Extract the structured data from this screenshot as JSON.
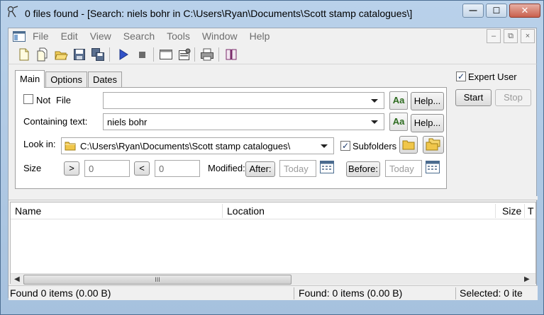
{
  "window": {
    "title": "0 files found - [Search: niels bohr in C:\\Users\\Ryan\\Documents\\Scott stamp catalogues\\]",
    "minimize": "—",
    "maximize": "☐",
    "close": "✕"
  },
  "menu": {
    "items": [
      "File",
      "Edit",
      "View",
      "Search",
      "Tools",
      "Window",
      "Help"
    ],
    "mdi_minimize": "–",
    "mdi_restore": "⧉",
    "mdi_close": "×"
  },
  "tabs": [
    "Main",
    "Options",
    "Dates"
  ],
  "form": {
    "not_label": "Not",
    "file_label": "File",
    "file_value": "",
    "containing_label": "Containing text:",
    "containing_value": "niels bohr",
    "aa_label": "Aa",
    "help_label": "Help...",
    "lookin_label": "Look in:",
    "lookin_value": "C:\\Users\\Ryan\\Documents\\Scott stamp catalogues\\",
    "subfolders_label": "Subfolders",
    "subfolders_checked": true,
    "not_checked": false,
    "size_label": "Size",
    "size_gt": ">",
    "size_lt": "<",
    "size_min": "0",
    "size_max": "0",
    "modified_label": "Modified:",
    "after_label": "After:",
    "after_value": "Today",
    "before_label": "Before:",
    "before_value": "Today"
  },
  "side": {
    "expert_label": "Expert User",
    "expert_checked": true,
    "start_label": "Start",
    "stop_label": "Stop"
  },
  "results": {
    "columns": [
      "Name",
      "Location",
      "Size",
      "T"
    ],
    "scroll_grip": "III"
  },
  "status": {
    "left": "Found 0 items (0.00 B)",
    "middle": "Found: 0 items (0.00 B)",
    "right": "Selected: 0 ite"
  },
  "icons": {
    "toolbar": [
      "new-search-icon",
      "new-window-icon",
      "open-icon",
      "save-icon",
      "save-as-icon",
      "start-icon",
      "stop-icon",
      "window-icon",
      "properties-icon",
      "print-icon",
      "help-book-icon"
    ]
  }
}
